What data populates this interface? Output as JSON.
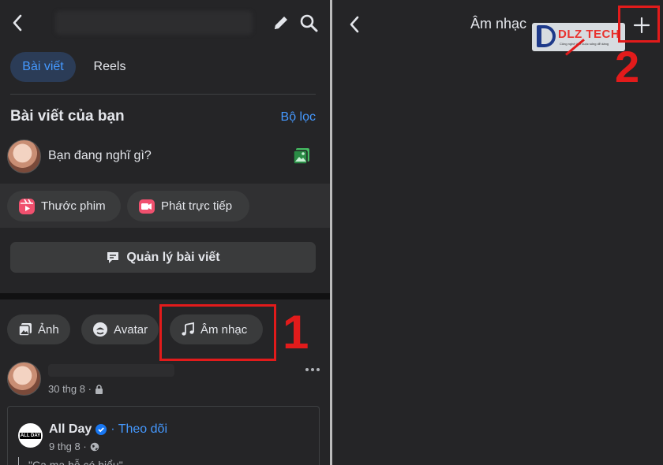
{
  "left": {
    "tabs": [
      {
        "label": "Bài viết",
        "active": true
      },
      {
        "label": "Reels",
        "active": false
      }
    ],
    "section_title": "Bài viết của bạn",
    "filter_link": "Bộ lọc",
    "composer_placeholder": "Bạn đang nghĩ gì?",
    "actions": [
      {
        "label": "Thước phim",
        "icon": "reels-icon"
      },
      {
        "label": "Phát trực tiếp",
        "icon": "live-video-icon"
      }
    ],
    "manage_posts_button": "Quản lý bài viết",
    "categories": [
      {
        "label": "Ảnh",
        "icon": "photo-icon"
      },
      {
        "label": "Avatar",
        "icon": "avatar-icon"
      },
      {
        "label": "Âm nhạc",
        "icon": "music-note-icon"
      }
    ],
    "post": {
      "date": "30 thg 8 ·",
      "shared": {
        "page_name": "All Day",
        "follow_label": "· Theo dõi",
        "date": "9 thg 8 ·",
        "logo_text": "ALL DAY",
        "snippet": "\"Ca ma hỗ có hiểu\""
      }
    },
    "annotation_number": "1"
  },
  "right": {
    "title": "Âm nhạc",
    "watermark_text": "DLZ TECH",
    "watermark_sub": "Công nghệ làm cuộc sống dễ dàng",
    "annotation_number": "2"
  },
  "colors": {
    "accent": "#4599ff",
    "annotation": "#e21b1b",
    "background": "#252527",
    "pill": "#3a3b3c"
  }
}
